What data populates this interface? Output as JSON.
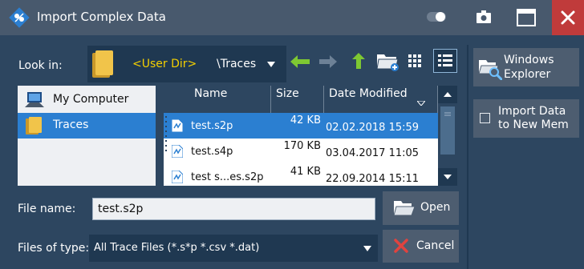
{
  "window": {
    "title": "Import Complex Data"
  },
  "toolbar": {
    "look_in_label": "Look in:",
    "path_user_dir": "<User Dir>",
    "path_rest": "\\Traces"
  },
  "nav": {
    "items": [
      {
        "label": "My Computer",
        "icon": "computer-icon"
      },
      {
        "label": "Traces",
        "icon": "folder-icon",
        "selected": true
      }
    ]
  },
  "files": {
    "columns": [
      "Name",
      "Size",
      "Date Modified"
    ],
    "rows": [
      {
        "name": "test.s2p",
        "size": "42 KB",
        "date": "02.02.2018 15:59",
        "selected": true
      },
      {
        "name": "test.s4p",
        "size": "170 KB",
        "date": "03.04.2017 11:05"
      },
      {
        "name": "test s...es.s2p",
        "size": "41 KB",
        "date": "22.09.2014 15:11"
      }
    ]
  },
  "form": {
    "file_name_label": "File name:",
    "file_name_value": "test.s2p",
    "file_type_label": "Files of type:",
    "file_type_value": "All Trace Files (*.s*p *.csv *.dat)"
  },
  "buttons": {
    "open": "Open",
    "cancel": "Cancel",
    "explorer_line1": "Windows",
    "explorer_line2": "Explorer",
    "import_line1": "Import Data",
    "import_line2": "to New Mem"
  },
  "colors": {
    "background": "#2d4660",
    "selection": "#2b7fd1",
    "close": "#c03b3b",
    "accent_yellow": "#f4d000",
    "arrow_green": "#7ec832"
  }
}
